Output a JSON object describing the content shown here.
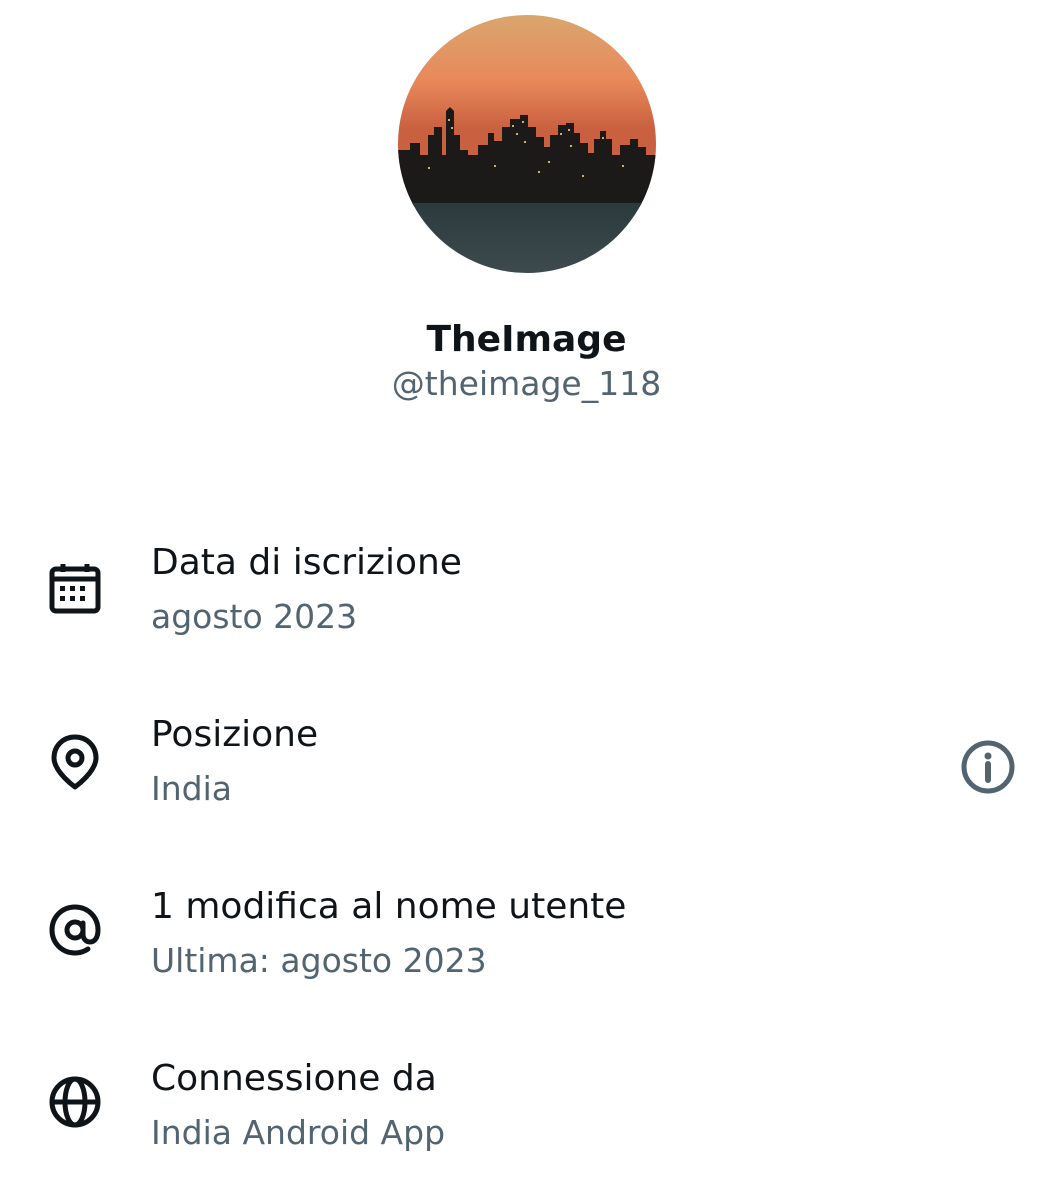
{
  "profile": {
    "display_name": "TheImage",
    "handle": "@theimage_118",
    "avatar_icon": "city-skyline-sunset-photo"
  },
  "rows": [
    {
      "icon": "calendar-icon",
      "title": "Data di iscrizione",
      "subtitle": "agosto 2023"
    },
    {
      "icon": "location-pin-icon",
      "title": "Posizione",
      "subtitle": "India",
      "action_icon": "info-icon"
    },
    {
      "icon": "at-sign-icon",
      "title": "1 modifica al nome utente",
      "subtitle": "Ultima: agosto 2023"
    },
    {
      "icon": "globe-icon",
      "title": "Connessione da",
      "subtitle": "India Android App"
    }
  ],
  "colors": {
    "primary_text": "#0f1419",
    "secondary_text": "#536471",
    "background": "#ffffff"
  }
}
